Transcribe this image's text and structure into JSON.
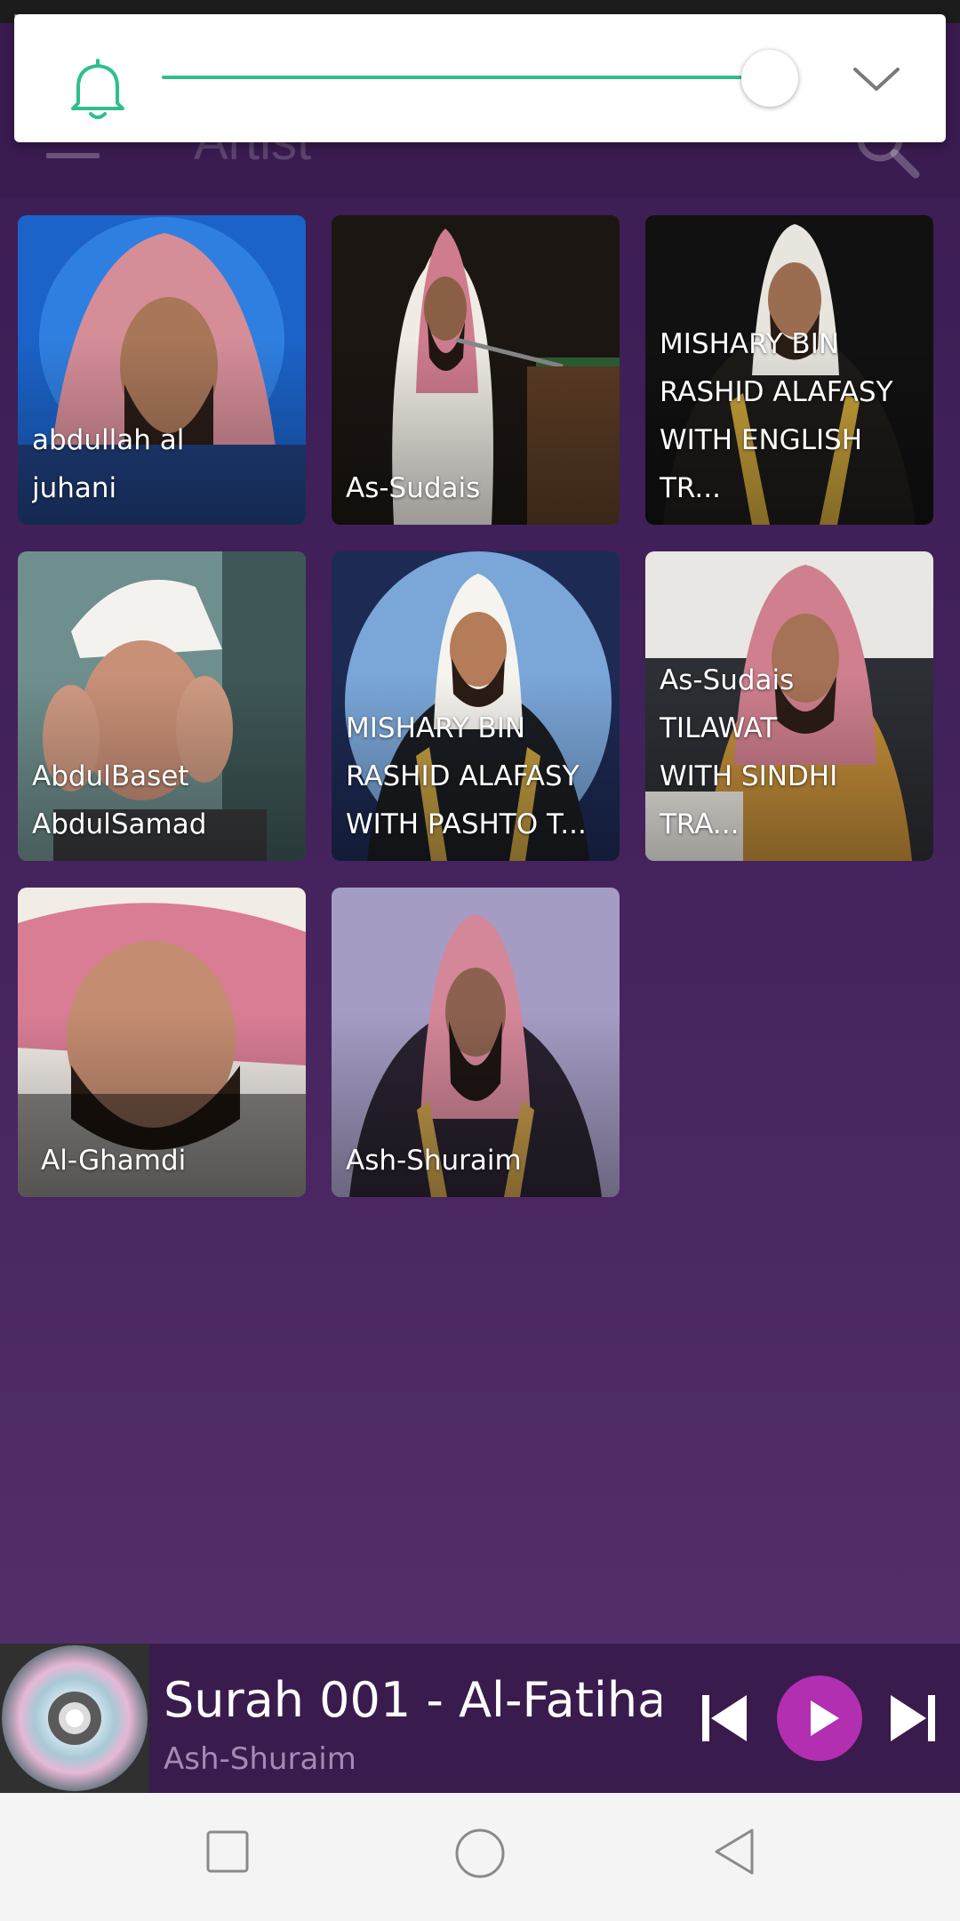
{
  "status_bar": {
    "left": "…",
    "center": "…",
    "right": "…"
  },
  "header": {
    "title": "Artist"
  },
  "volume_popup": {
    "level_percent": 94
  },
  "artists": [
    {
      "name": "abdullah al\njuhani"
    },
    {
      "name": "As-Sudais"
    },
    {
      "name": "MISHARY BIN\nRASHID ALAFASY\nWITH ENGLISH TR..."
    },
    {
      "name": "AbdulBaset\nAbdulSamad"
    },
    {
      "name": "MISHARY BIN\nRASHID ALAFASY\nWITH PASHTO  T..."
    },
    {
      "name": "As-Sudais\nTILAWAT\nWITH SINDHI TRA..."
    },
    {
      "name": "Al-Ghamdi"
    },
    {
      "name": "Ash-Shuraim"
    }
  ],
  "now_playing": {
    "title": "Surah 001 - Al-Fatiha",
    "artist": "Ash-Shuraim"
  },
  "colors": {
    "accent_green": "#2fbf8b",
    "play_purple": "#b12fb0",
    "background": "#43225c"
  }
}
